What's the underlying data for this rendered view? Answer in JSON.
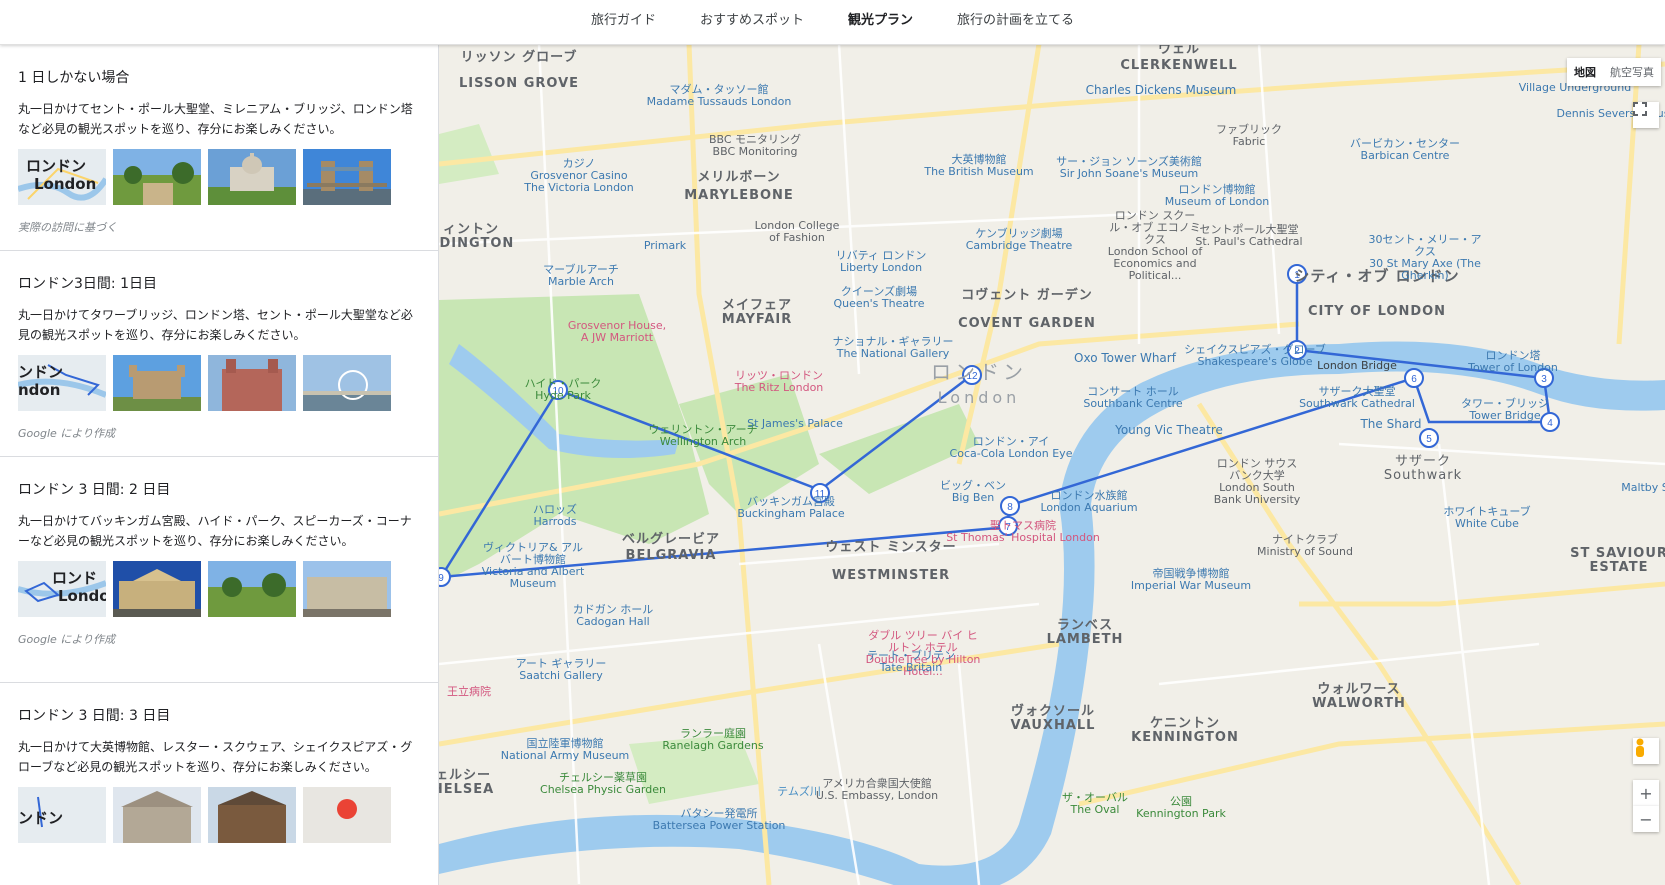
{
  "nav": {
    "tabs": [
      "旅行ガイド",
      "おすすめスポット",
      "観光プラン",
      "旅行の計画を立てる"
    ],
    "active_index": 2
  },
  "plans": [
    {
      "title": "1 日しかない場合",
      "desc": "丸一日かけてセント・ポール大聖堂、ミレニアム・ブリッジ、ロンドン塔など必見の観光スポットを巡り、存分にお楽しみください。",
      "note": "実際の訪問に基づく",
      "map_thumb_text": [
        "ロンドン",
        "London"
      ]
    },
    {
      "title": "ロンドン3日間: 1日目",
      "desc": "丸一日かけてタワーブリッジ、ロンドン塔、セント・ポール大聖堂など必見の観光スポットを巡り、存分にお楽しみください。",
      "note": "Google により作成",
      "map_thumb_text": [
        "ンドン",
        "ndon"
      ]
    },
    {
      "title": "ロンドン 3 日間: 2 日目",
      "desc": "丸一日かけてバッキンガム宮殿、ハイド・パーク、スピーカーズ・コーナーなど必見の観光スポットを巡り、存分にお楽しみください。",
      "note": "Google により作成",
      "map_thumb_text": [
        "ロンド",
        "Londo"
      ]
    },
    {
      "title": "ロンドン 3 日間: 3 日目",
      "desc": "丸一日かけて大英博物館、レスター・スクウェア、シェイクスピアズ・グローブなど必見の観光スポットを巡り、存分にお楽しみください。",
      "note": "",
      "map_thumb_text": [
        "ンドン",
        ""
      ]
    }
  ],
  "map": {
    "controls": {
      "map_label": "地図",
      "satellite_label": "航空写真",
      "zoom_in": "+",
      "zoom_out": "−"
    },
    "markers": [
      "1",
      "2",
      "3",
      "4",
      "5",
      "6",
      "7",
      "8",
      "9",
      "10",
      "11",
      "12"
    ],
    "labels": {
      "city_jp": "ロンドン",
      "city_en": "London",
      "lisson_jp": "リッソン グローブ",
      "lisson_en": "LISSON GROVE",
      "clerkenwell_jp": "ウェル",
      "clerkenwell_en": "CLERKENWELL",
      "marylebone_jp": "メリルボーン",
      "marylebone_en": "MARYLEBONE",
      "mayfair_jp": "メイフェア",
      "mayfair_en": "MAYFAIR",
      "covent_jp": "コヴェント ガーデン",
      "covent_en": "COVENT GARDEN",
      "cityof_jp": "シティ・オブ ロンドン",
      "cityof_en": "CITY OF LONDON",
      "belgravia_jp": "ベルグレービア",
      "belgravia_en": "BELGRAVIA",
      "westminster_jp": "ウェスト ミンスター",
      "westminster_en": "WESTMINSTER",
      "lambeth_jp": "ランベス",
      "lambeth_en": "LAMBETH",
      "vauxhall_jp": "ヴォクソール",
      "vauxhall_en": "VAUXHALL",
      "kennington_jp": "ケニントン",
      "kennington_en": "KENNINGTON",
      "walworth_jp": "ウォルワース",
      "walworth_en": "WALWORTH",
      "southwark_jp": "サザーク",
      "southwark_en": "Southwark",
      "chelsea_jp": "ェルシー",
      "chelsea_en": "HELSEA",
      "paddington_jp": "ィントン",
      "paddington_en": "DDINGTON",
      "stsaviour_jp": "ST SAVIOUR",
      "stsaviour_en": "ESTATE",
      "museum_jp": "大英博物館",
      "museum_en": "The British Museum",
      "madame_jp": "マダム・タッソー館",
      "madame_en": "Madame Tussauds London",
      "bbc_jp": "BBC モニタリング",
      "bbc_en": "BBC Monitoring",
      "casino_jp": "カジノ",
      "casino_en": "Grosvenor Casino The Victoria London",
      "primark": "Primark",
      "marble_jp": "マーブルアーチ",
      "marble_en": "Marble Arch",
      "grosvenor_jp": "Grosvenor House,",
      "grosvenor_en": "A JW Marriott",
      "hyde_jp": "ハイド・パーク",
      "hyde_en": "Hyde Park",
      "wellington_jp": "ウェリントン・アーチ",
      "wellington_en": "Wellington Arch",
      "ritz_jp": "リッツ・ロンドン",
      "ritz_en": "The Ritz London",
      "liberty_jp": "リバティ ロンドン",
      "liberty_en": "Liberty London",
      "queens_jp": "クイーンズ劇場",
      "queens_en": "Queen's Theatre",
      "lcf_jp": "London College",
      "lcf_en": "of Fashion",
      "cambridge_jp": "ケンブリッジ劇場",
      "cambridge_en": "Cambridge Theatre",
      "gallery_jp": "ナショナル・ギャラリー",
      "gallery_en": "The National Gallery",
      "stjames": "St James's Palace",
      "buckingham_jp": "バッキンガム宮殿",
      "buckingham_en": "Buckingham Palace",
      "bigben_jp": "ビッグ・ベン",
      "bigben_en": "Big Ben",
      "eye_jp": "ロンドン・アイ",
      "eye_en": "Coca-Cola London Eye",
      "aquarium_jp": "ロンドン水族館",
      "aquarium_en": "London Aquarium",
      "stthomas_jp": "聖トマス病院",
      "stthomas_en": "St Thomas' Hospital London",
      "southbank_jp": "コンサート ホール",
      "southbank_en": "Southbank Centre",
      "youngvic": "Young Vic Theatre",
      "oxo": "Oxo Tower Wharf",
      "globe_jp": "シェイクスピアズ・グローブ",
      "globe_en": "Shakespeare's Globe",
      "londonbridge": "London Bridge",
      "cathedral_jp": "サザーク大聖堂",
      "cathedral_en": "Southwark Cathedral",
      "shard": "The Shard",
      "tower_jp": "ロンドン塔",
      "tower_en": "Tower of London",
      "towerbridge_jp": "タワー・ブリッジ",
      "towerbridge_en": "Tower Bridge",
      "stpauls_jp": "セントポール大聖堂",
      "stpauls_en": "St. Paul's Cathedral",
      "museumlondon_jp": "ロンドン博物館",
      "museumlondon_en": "Museum of London",
      "barbican_jp": "バービカン・センター",
      "barbican_en": "Barbican Centre",
      "gherkin_jp": "30セント・メリー・アクス",
      "gherkin_en": "30 St Mary Axe (The Gherkin)",
      "dickens": "Charles Dickens Museum",
      "soane_jp": "サー・ジョン ソーンズ美術館",
      "soane_en": "Sir John Soane's Museum",
      "lse_jp": "ロンドン スクール・オブ エコノミクス",
      "lse_en": "London School of Economics and Political...",
      "fabric_jp": "ファブリック",
      "fabric_en": "Fabric",
      "lsbu_jp": "ロンドン サウス バンク大学",
      "lsbu_en": "London South Bank University",
      "nightclub_jp": "ナイトクラブ",
      "nightclub_en": "Ministry of Sound",
      "warmuseum_jp": "帝国戦争博物館",
      "warmuseum_en": "Imperial War Museum",
      "whitecube_jp": "ホワイトキューブ",
      "whitecube_en": "White Cube",
      "harrods_jp": "ハロッズ",
      "harrods_en": "Harrods",
      "va_jp": "ヴィクトリア& アルバート博物館",
      "va_en": "Victoria and Albert Museum",
      "cadogan_jp": "カドガン ホール",
      "cadogan_en": "Cadogan Hall",
      "saatchi_jp": "アート ギャラリー",
      "saatchi_en": "Saatchi Gallery",
      "doubletree_jp": "ダブル ツリー バイ ヒルトン ホテル",
      "doubletree_en": "DoubleTree by Hilton Hotel...",
      "tate_jp": "テート・ブリテン",
      "tate_en": "Tate Britain",
      "ranelagh_jp": "ランラー庭園",
      "ranelagh_en": "Ranelagh Gardens",
      "army_jp": "国立陸軍博物館",
      "army_en": "National Army Museum",
      "physic_jp": "チェルシー薬草園",
      "physic_en": "Chelsea Physic Garden",
      "usembassy_jp": "アメリカ合衆国大使館",
      "usembassy_en": "U.S. Embassy, London",
      "oval_jp": "ザ・オーバル",
      "oval_en": "The Oval",
      "kpark_jp": "公園",
      "kpark_en": "Kennington Park",
      "battersea_jp": "バタシー発電所",
      "battersea_en": "Battersea Power Station",
      "thames": "テムズ川",
      "royalhosp": "王立病院",
      "maltby": "Maltby S",
      "dennis": "Dennis Severs' Hous",
      "village": "Village Underground"
    }
  }
}
